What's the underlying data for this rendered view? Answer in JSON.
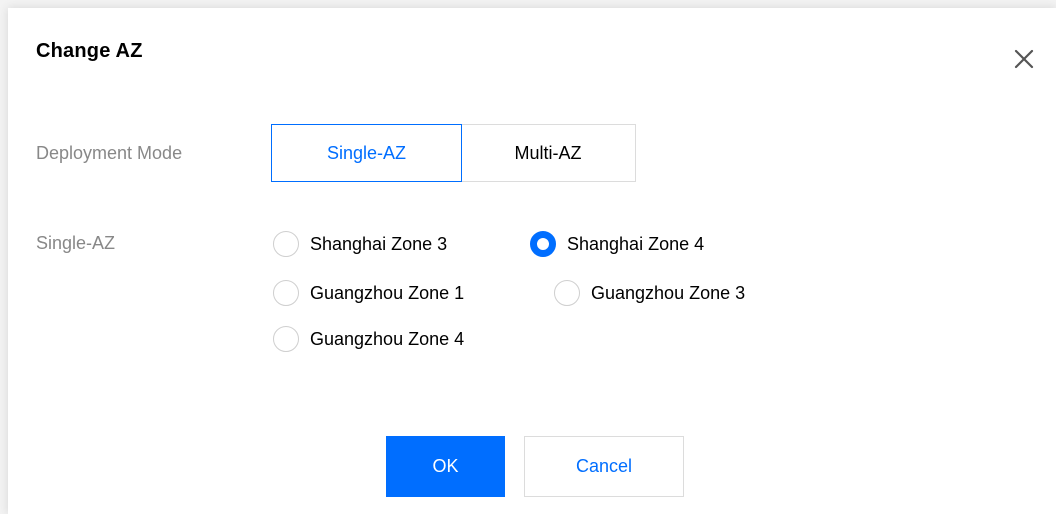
{
  "dialog": {
    "title": "Change AZ",
    "close_icon": "close-icon"
  },
  "deployment": {
    "label": "Deployment Mode",
    "options": [
      "Single-AZ",
      "Multi-AZ"
    ],
    "selected": "Single-AZ"
  },
  "zones": {
    "label": "Single-AZ",
    "options": [
      {
        "label": "Shanghai Zone 3",
        "checked": false
      },
      {
        "label": "Shanghai Zone 4",
        "checked": true
      },
      {
        "label": "Guangzhou Zone 1",
        "checked": false
      },
      {
        "label": "Guangzhou Zone 3",
        "checked": false
      },
      {
        "label": "Guangzhou Zone 4",
        "checked": false
      }
    ]
  },
  "footer": {
    "ok_label": "OK",
    "cancel_label": "Cancel"
  },
  "colors": {
    "accent": "#006eff",
    "label_gray": "#888888",
    "border": "#dcdcdc"
  }
}
